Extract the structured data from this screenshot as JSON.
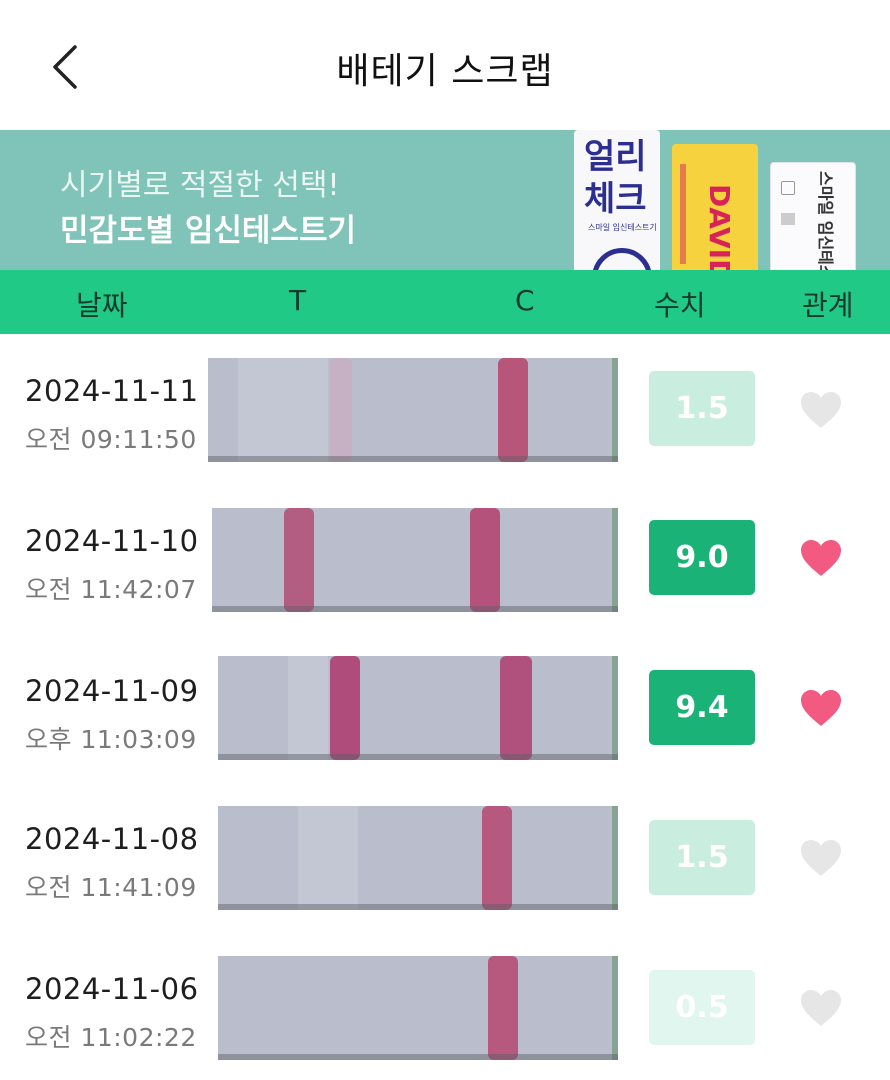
{
  "header": {
    "title": "배테기 스크랩"
  },
  "banner": {
    "subtitle": "시기별로 적절한 선택!",
    "title": "민감도별 임신테스트기",
    "products": [
      {
        "text": "얼리\n체크",
        "small": "스마일 임신테스트기"
      },
      {
        "text": "DAVID -SUPE"
      },
      {
        "text": "스마일 임신테스트기"
      }
    ]
  },
  "columns": {
    "date": "날짜",
    "t": "T",
    "c": "C",
    "value": "수치",
    "relation": "관계"
  },
  "rows": [
    {
      "date": "2024-11-11",
      "time": "오전 09:11:50",
      "value": "1.5",
      "level": "low",
      "heart": false
    },
    {
      "date": "2024-11-10",
      "time": "오전 11:42:07",
      "value": "9.0",
      "level": "high",
      "heart": true
    },
    {
      "date": "2024-11-09",
      "time": "오후 11:03:09",
      "value": "9.4",
      "level": "high",
      "heart": true
    },
    {
      "date": "2024-11-08",
      "time": "오전 11:41:09",
      "value": "1.5",
      "level": "low",
      "heart": false
    },
    {
      "date": "2024-11-06",
      "time": "오전 11:02:22",
      "value": "0.5",
      "level": "lower",
      "heart": false
    }
  ],
  "colors": {
    "accent": "#20c985",
    "banner": "#80c3b8",
    "badge_high": "#1ab277",
    "badge_low": "#c9eee0",
    "heart_active": "#f25a82",
    "heart_inactive": "#e6e6e6"
  }
}
